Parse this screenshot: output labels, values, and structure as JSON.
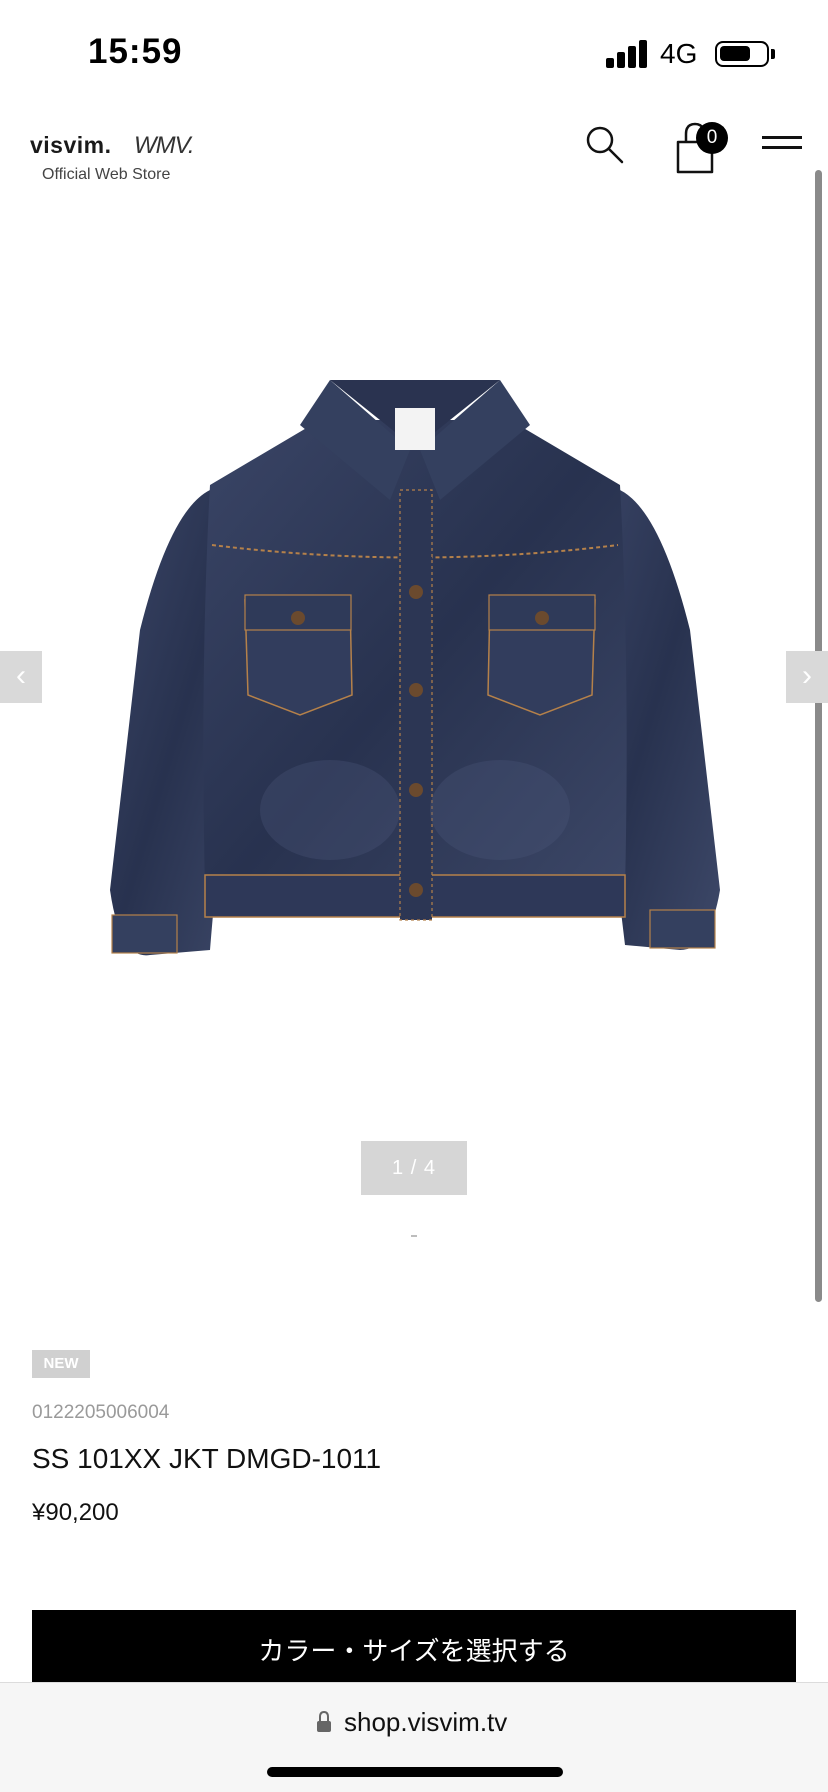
{
  "status_bar": {
    "time": "15:59",
    "network": "4G",
    "signal_icon": "cellular-signal-icon",
    "battery_icon": "battery-icon"
  },
  "header": {
    "logo_primary": "visvim.",
    "logo_secondary": "WMV.",
    "logo_subtitle": "Official Web Store",
    "search_icon": "search-icon",
    "cart_icon": "shopping-bag-icon",
    "cart_count": "0",
    "menu_icon": "hamburger-menu-icon"
  },
  "gallery": {
    "prev_label": "‹",
    "next_label": "›",
    "counter": "1 / 4",
    "image_alt": "denim-jacket-photo",
    "current_index": 1,
    "total": 4
  },
  "product": {
    "badge": "NEW",
    "sku": "0122205006004",
    "name": "SS 101XX JKT DMGD-1011",
    "price": "¥90,200",
    "select_button": "カラー・サイズを選択する"
  },
  "browser": {
    "url": "shop.visvim.tv",
    "lock_icon": "lock-icon"
  },
  "colors": {
    "denim": "#2b3553",
    "button_bg": "#000000",
    "muted_gray": "#d6d6d6",
    "sku_gray": "#9a9a9a"
  }
}
